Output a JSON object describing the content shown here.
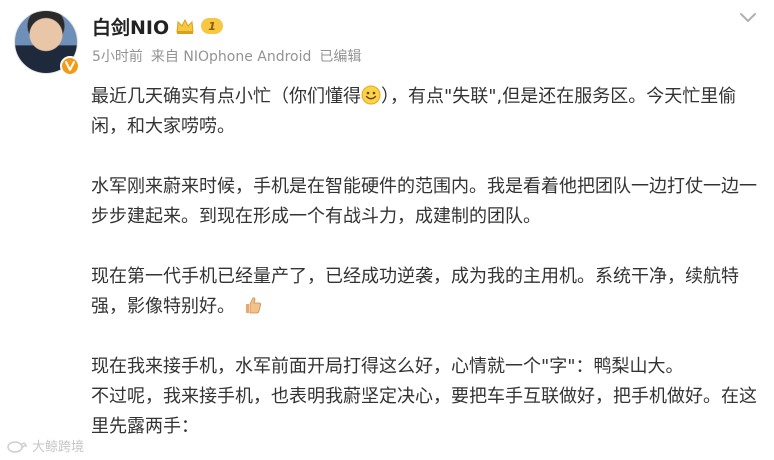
{
  "author": {
    "name": "白剑NIO",
    "level": "1"
  },
  "meta": {
    "time": "5小时前",
    "source": "来自 NIOphone Android",
    "edited": "已编辑"
  },
  "post": {
    "p1_a": "最近几天确实有点小忙（你们懂得",
    "p1_b": "），有点\"失联\",但是还在服务区。今天忙里偷闲，和大家唠唠。",
    "p2": "水军刚来蔚来时候，手机是在智能硬件的范围内。我是看着他把团队一边打仗一边一步步建起来。到现在形成一个有战斗力，成建制的团队。",
    "p3": "现在第一代手机已经量产了，已经成功逆袭，成为我的主用机。系统干净，续航特强，影像特别好。",
    "p4_1": "现在我来接手机，水军前面开局打得这么好，心情就一个\"字\"：鸭梨山大。",
    "p4_2": "不过呢，我来接手机，也表明我蔚坚定决心，要把车手互联做好，把手机做好。在这里先露两手："
  },
  "watermark": {
    "text": "大鲸跨境"
  },
  "icons": {
    "verified": "verified-v-icon",
    "crown": "crown-icon",
    "more": "chevron-down-icon",
    "smile": "smile-emoji-icon",
    "thumb": "thumbs-up-emoji-icon"
  },
  "colors": {
    "name": "#222222",
    "meta": "#939393",
    "body": "#333333",
    "verified": "#f39b17",
    "level_badge": "#f7c744"
  }
}
